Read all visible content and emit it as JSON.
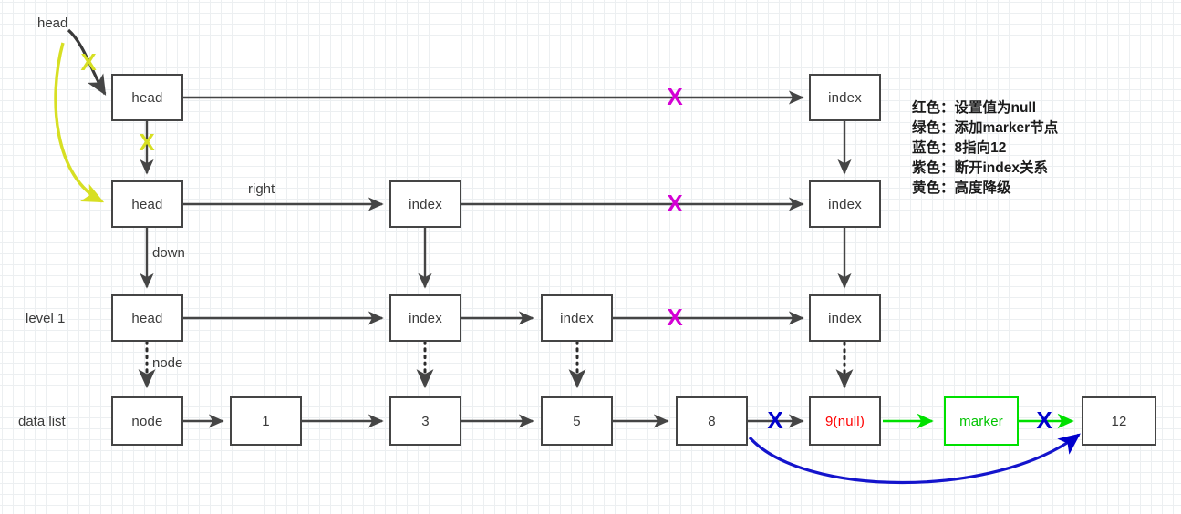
{
  "diagram": {
    "title_label": "head",
    "row_labels": [
      {
        "id": "level1",
        "text": "level 1"
      },
      {
        "id": "datalist",
        "text": "data list"
      }
    ],
    "edge_labels": [
      {
        "id": "right",
        "text": "right"
      },
      {
        "id": "down",
        "text": "down"
      },
      {
        "id": "node",
        "text": "node"
      }
    ],
    "nodes": {
      "level3": [
        {
          "id": "head-l3",
          "label": "head"
        },
        {
          "id": "index-l3-right",
          "label": "index"
        }
      ],
      "level2": [
        {
          "id": "head-l2",
          "label": "head"
        },
        {
          "id": "index-l2-mid",
          "label": "index"
        },
        {
          "id": "index-l2-right",
          "label": "index"
        }
      ],
      "level1": [
        {
          "id": "head-l1",
          "label": "head"
        },
        {
          "id": "index-l1-a",
          "label": "index"
        },
        {
          "id": "index-l1-b",
          "label": "index"
        },
        {
          "id": "index-l1-right",
          "label": "index"
        }
      ],
      "datalist": [
        {
          "id": "node-data",
          "label": "node"
        },
        {
          "id": "data-1",
          "label": "1"
        },
        {
          "id": "data-3",
          "label": "3"
        },
        {
          "id": "data-5",
          "label": "5"
        },
        {
          "id": "data-8",
          "label": "8"
        },
        {
          "id": "data-9null",
          "label": "9(null)"
        },
        {
          "id": "data-marker",
          "label": "marker"
        },
        {
          "id": "data-12",
          "label": "12"
        }
      ]
    },
    "markers": [
      {
        "id": "x-yellow-top",
        "glyph": "X",
        "color": "yellow"
      },
      {
        "id": "x-yellow-down",
        "glyph": "X",
        "color": "yellow"
      },
      {
        "id": "x-magenta-l3",
        "glyph": "X",
        "color": "magenta"
      },
      {
        "id": "x-magenta-l2",
        "glyph": "X",
        "color": "magenta"
      },
      {
        "id": "x-magenta-l1",
        "glyph": "X",
        "color": "magenta"
      },
      {
        "id": "x-blue-8-9",
        "glyph": "X",
        "color": "blue"
      },
      {
        "id": "x-blue-marker-12",
        "glyph": "X",
        "color": "blue"
      }
    ],
    "legend": {
      "lines": [
        "红色：设置值为null",
        "绿色：添加marker节点",
        "蓝色：8指向12",
        "紫色：断开index关系",
        "黄色：高度降级"
      ]
    },
    "colors": {
      "red": "#ff0000",
      "green": "#00e000",
      "blue": "#0000cc",
      "magenta": "#d400d4",
      "yellow": "#d7df23",
      "stroke": "#454545"
    }
  }
}
